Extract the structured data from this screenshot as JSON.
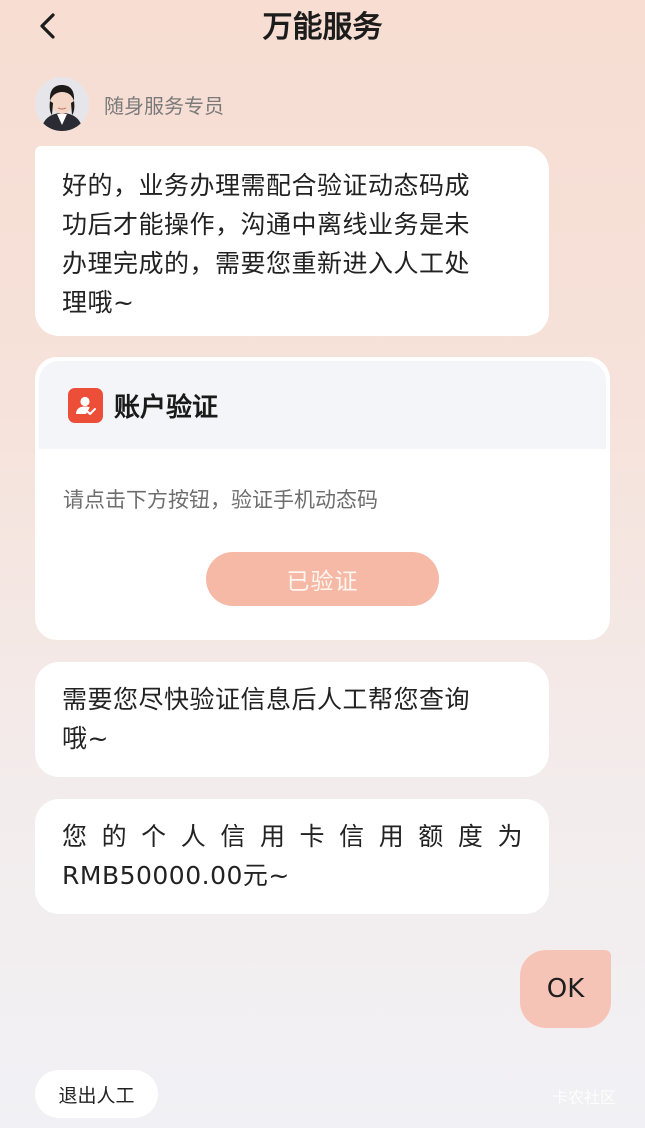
{
  "header": {
    "title": "万能服务",
    "back_icon": "chevron-left-icon"
  },
  "agent": {
    "name": "随身服务专员"
  },
  "messages": {
    "msg1": {
      "line1": "好的，业务办理需配合验证动态码成",
      "line2": "功后才能操作，沟通中离线业务是未",
      "line3": "办理完成的，需要您重新进入人工处",
      "line4": "理哦~"
    },
    "msg2": {
      "line1": "需要您尽快验证信息后人工帮您查询",
      "line2": "哦~"
    },
    "msg3": {
      "line1": "您的个人信用卡信用额度为",
      "line2": "RMB50000.00元~"
    },
    "user_reply": "OK"
  },
  "verify_card": {
    "title": "账户验证",
    "description": "请点击下方按钮，验证手机动态码",
    "button_label": "已验证",
    "icon": "user-verify-icon"
  },
  "footer": {
    "exit_label": "退出人工",
    "watermark": "卡农社区"
  },
  "colors": {
    "accent": "#ec4e37",
    "button_disabled": "#f5b9a5",
    "user_bubble": "#f6c4b7"
  }
}
